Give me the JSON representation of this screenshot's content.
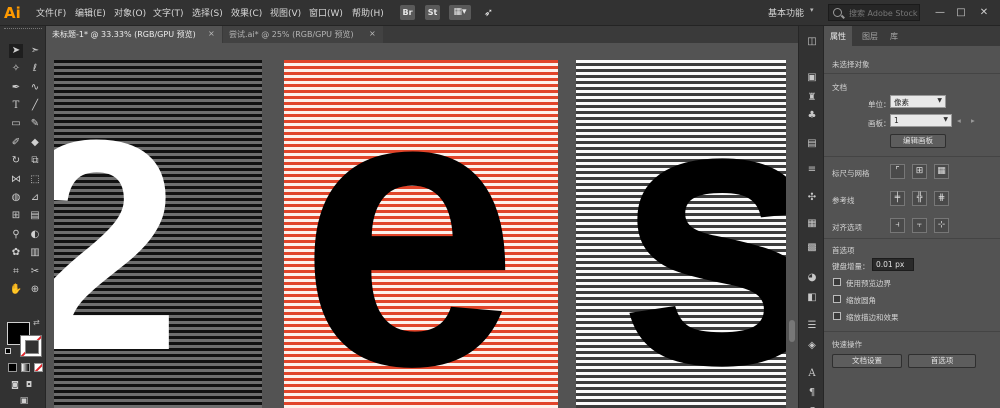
{
  "app": {
    "logo": "Ai"
  },
  "menu": [
    "文件(F)",
    "编辑(E)",
    "对象(O)",
    "文字(T)",
    "选择(S)",
    "效果(C)",
    "视图(V)",
    "窗口(W)",
    "帮助(H)"
  ],
  "menubar_icons": {
    "bridge": "Br",
    "stock": "St"
  },
  "workspace": {
    "label": "基本功能",
    "caret": "▾"
  },
  "stock_search": {
    "placeholder": "搜索 Adobe Stock"
  },
  "window_controls": {
    "minimize": "—",
    "maximize": "□",
    "close": "✕"
  },
  "tabs": [
    {
      "label": "未标题-1* @ 33.33% (RGB/GPU 预览)",
      "close": "×",
      "active": true
    },
    {
      "label": "尝试.ai* @ 25% (RGB/GPU 预览)",
      "close": "×",
      "active": false
    }
  ],
  "canvas": {
    "artboards": [
      {
        "glyph": "2",
        "stripe_colors": [
          "#111111",
          "#6e6e6e"
        ],
        "glyph_color": "#ffffff"
      },
      {
        "glyph": "e",
        "stripe_colors": [
          "#e1452a",
          "#fdf1ec"
        ],
        "glyph_color": "#000000"
      },
      {
        "glyph": "s",
        "stripe_colors": [
          "#fafafa",
          "#3c3c3c"
        ],
        "glyph_color": "#000000"
      }
    ]
  },
  "toolbar": {
    "tools": [
      "selection",
      "direct-selection",
      "magic-wand",
      "lasso",
      "pen",
      "curvature",
      "type",
      "line",
      "rectangle",
      "paintbrush",
      "shaper",
      "eraser",
      "rotate",
      "scale",
      "width",
      "free-transform",
      "shape-builder",
      "perspective",
      "mesh",
      "gradient",
      "eyedropper",
      "blend",
      "symbol-sprayer",
      "column-graph",
      "artboard",
      "slice",
      "hand",
      "zoom"
    ],
    "fill_color": "#000000",
    "stroke_color": "none"
  },
  "panel": {
    "tabs": [
      "属性",
      "图层",
      "库"
    ],
    "no_selection": "未选择对象",
    "document": {
      "title": "文档",
      "unit_label": "单位：",
      "unit_value": "像素",
      "artboard_label": "画板：",
      "artboard_value": "1",
      "edit_artboards_button": "编辑画板"
    },
    "rulers_grids": "标尺与网格",
    "guides": "参考线",
    "snap_options": "对齐选项",
    "preferences": {
      "title": "首选项",
      "keyboard_increment_label": "键盘增量：",
      "keyboard_increment_value": "0.01 px",
      "use_preview_bounds": "使用预览边界",
      "scale_corners": "缩放圆角",
      "scale_strokes_effects": "缩放描边和效果"
    },
    "quick_actions": {
      "title": "快速操作",
      "doc_setup_button": "文档设置",
      "preferences_button": "首选项"
    }
  }
}
